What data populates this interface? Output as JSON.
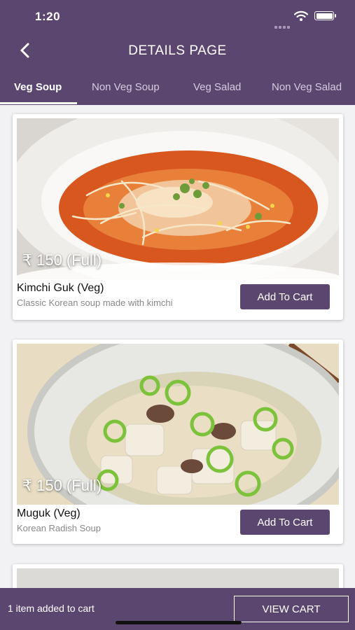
{
  "status_bar": {
    "time": "1:20"
  },
  "header": {
    "title": "DETAILS PAGE",
    "back_icon": "chevron-left-icon"
  },
  "tabs": [
    {
      "label": "Veg Soup",
      "active": true
    },
    {
      "label": "Non Veg Soup",
      "active": false
    },
    {
      "label": "Veg Salad",
      "active": false
    },
    {
      "label": "Non Veg Salad",
      "active": false
    }
  ],
  "products": [
    {
      "price": "₹ 150 (Full)",
      "name": "Kimchi Guk (Veg)",
      "description": "Classic Korean soup made with kimchi",
      "button": "Add To Cart"
    },
    {
      "price": "₹ 150 (Full)",
      "name": "Muguk (Veg)",
      "description": "Korean Radish Soup",
      "button": "Add To Cart"
    }
  ],
  "cart_bar": {
    "message": "1 item added to cart",
    "button": "VIEW CART"
  },
  "colors": {
    "primary": "#5b4670",
    "background": "#f2f2f4"
  }
}
